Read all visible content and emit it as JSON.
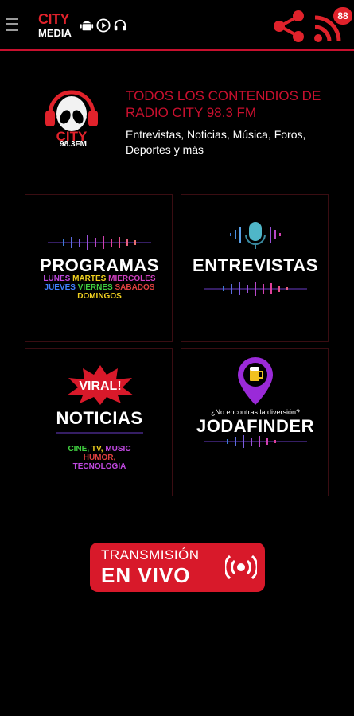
{
  "app": {
    "logo_city": "CITY",
    "logo_media": "MEDIA",
    "notification_count": "88",
    "brand_color": "#c8102e"
  },
  "header": {
    "station_name": "CITY",
    "station_frequency": "98.3FM",
    "headline": "TODOS LOS CONTENDIOS DE RADIO CITY 98.3 FM",
    "subline": "Entrevistas, Noticias, Música, Foros, Deportes y más"
  },
  "tiles": [
    {
      "title": "PROGRAMAS",
      "subtitle_line1a": "LUNES",
      "subtitle_line1b": "MARTES",
      "subtitle_line1c": "MIERCOLES",
      "subtitle_line2a": "JUEVES",
      "subtitle_line2b": "VIERNES",
      "subtitle_line2c": "SABADOS",
      "subtitle_line3": "DOMINGOS"
    },
    {
      "title": "ENTREVISTAS"
    },
    {
      "badge": "VIRAL!",
      "title": "NOTICIAS",
      "topics_a": "CINE,",
      "topics_b": "TV,",
      "topics_c": "MUSIC",
      "topics_d": "HUMOR,",
      "topics_e": "TECNOLOGIA"
    },
    {
      "tagline": "¿No encontras la diversión?",
      "title": "JODAFINDER"
    }
  ],
  "live": {
    "line1": "TRANSMISIÓN",
    "line2": "EN VIVO"
  },
  "icons": {
    "menu": "hamburger-icon",
    "share": "share-icon",
    "rss": "rss-icon",
    "android": "android-icon",
    "play": "play-icon",
    "headphones": "headphones-icon",
    "alien": "alien-headphones-icon",
    "mic": "microphone-icon",
    "pin": "beer-location-pin-icon",
    "broadcast": "broadcast-icon"
  }
}
